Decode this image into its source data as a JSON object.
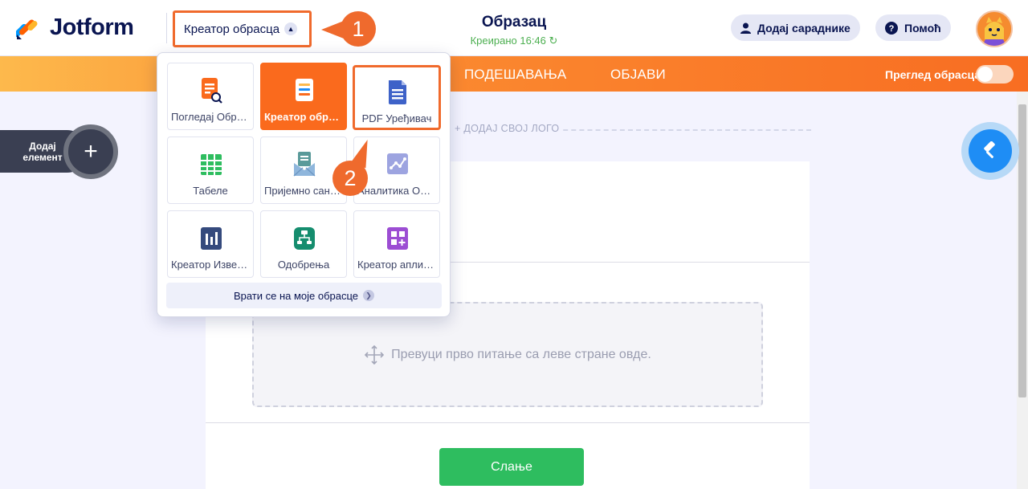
{
  "app": {
    "logo_text": "Jotform"
  },
  "header": {
    "builder_select_label": "Креатор обрасца",
    "form_title": "Образац",
    "form_status": "Креирано 16:46",
    "add_collaborators": "Додај сараднике",
    "help": "Помоћ"
  },
  "callouts": {
    "first": "1",
    "second": "2"
  },
  "navbar": {
    "tabs": [
      "ПОДЕШАВАЊА",
      "ОБЈАВИ"
    ],
    "preview_label": "Преглед обрасца"
  },
  "sidebar": {
    "add_element_line1": "Додај",
    "add_element_line2": "елемент"
  },
  "canvas": {
    "add_logo": "+ ДОДАЈ СВОЈ ЛОГО",
    "drop_hint": "Превуци прво питање са леве стране овде.",
    "submit": "Слање"
  },
  "dropdown": {
    "tiles": [
      {
        "label": "Погледај Обрасце",
        "icon": "form-view-icon",
        "color": "#fa6a1d"
      },
      {
        "label": "Креатор обрасца",
        "icon": "form-builder-icon",
        "color": "#ffffff"
      },
      {
        "label": "PDF Уређивач",
        "icon": "pdf-editor-icon",
        "color": "#3e62c8"
      },
      {
        "label": "Табеле",
        "icon": "tables-icon",
        "color": "#2ebd5f"
      },
      {
        "label": "Пријемно сандуче",
        "icon": "inbox-icon",
        "color": "#5a8bb5"
      },
      {
        "label": "Аналитика Обрасца",
        "icon": "analytics-icon",
        "color": "#9da4e0"
      },
      {
        "label": "Креатор Извештаја",
        "icon": "report-builder-icon",
        "color": "#354a7d"
      },
      {
        "label": "Одобрења",
        "icon": "approvals-icon",
        "color": "#158d6e"
      },
      {
        "label": "Креатор апликација",
        "icon": "app-builder-icon",
        "color": "#9c4dd3"
      }
    ],
    "back_label": "Врати се на моје обрасце"
  },
  "colors": {
    "brand_orange": "#fa6a1d",
    "navy": "#0a1551",
    "submit_green": "#2ebd5f",
    "callout": "#ef6a2d"
  }
}
